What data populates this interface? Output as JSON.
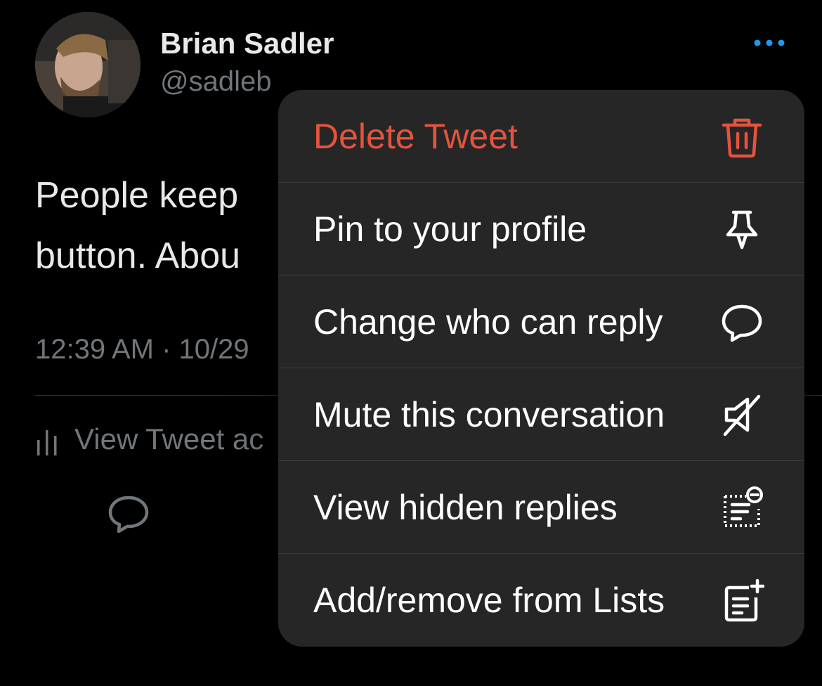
{
  "tweet": {
    "author_name": "Brian Sadler",
    "author_handle": "@sadleb",
    "text_lines": [
      "People keep",
      "button. Abou"
    ],
    "meta": "12:39 AM · 10/29",
    "analytics_label": "View Tweet ac"
  },
  "menu": {
    "items": [
      {
        "label": "Delete Tweet",
        "icon": "trash-icon",
        "destructive": true
      },
      {
        "label": "Pin to your profile",
        "icon": "pin-icon"
      },
      {
        "label": "Change who can reply",
        "icon": "speech-bubble-icon"
      },
      {
        "label": "Mute this conversation",
        "icon": "muted-speaker-icon"
      },
      {
        "label": "View hidden replies",
        "icon": "hidden-replies-icon"
      },
      {
        "label": "Add/remove from Lists",
        "icon": "add-to-list-icon"
      }
    ]
  },
  "colors": {
    "background": "#000000",
    "menu_background": "#262626",
    "destructive": "#e5533d",
    "accent": "#1d9bf0",
    "secondary_text": "#71767b"
  }
}
